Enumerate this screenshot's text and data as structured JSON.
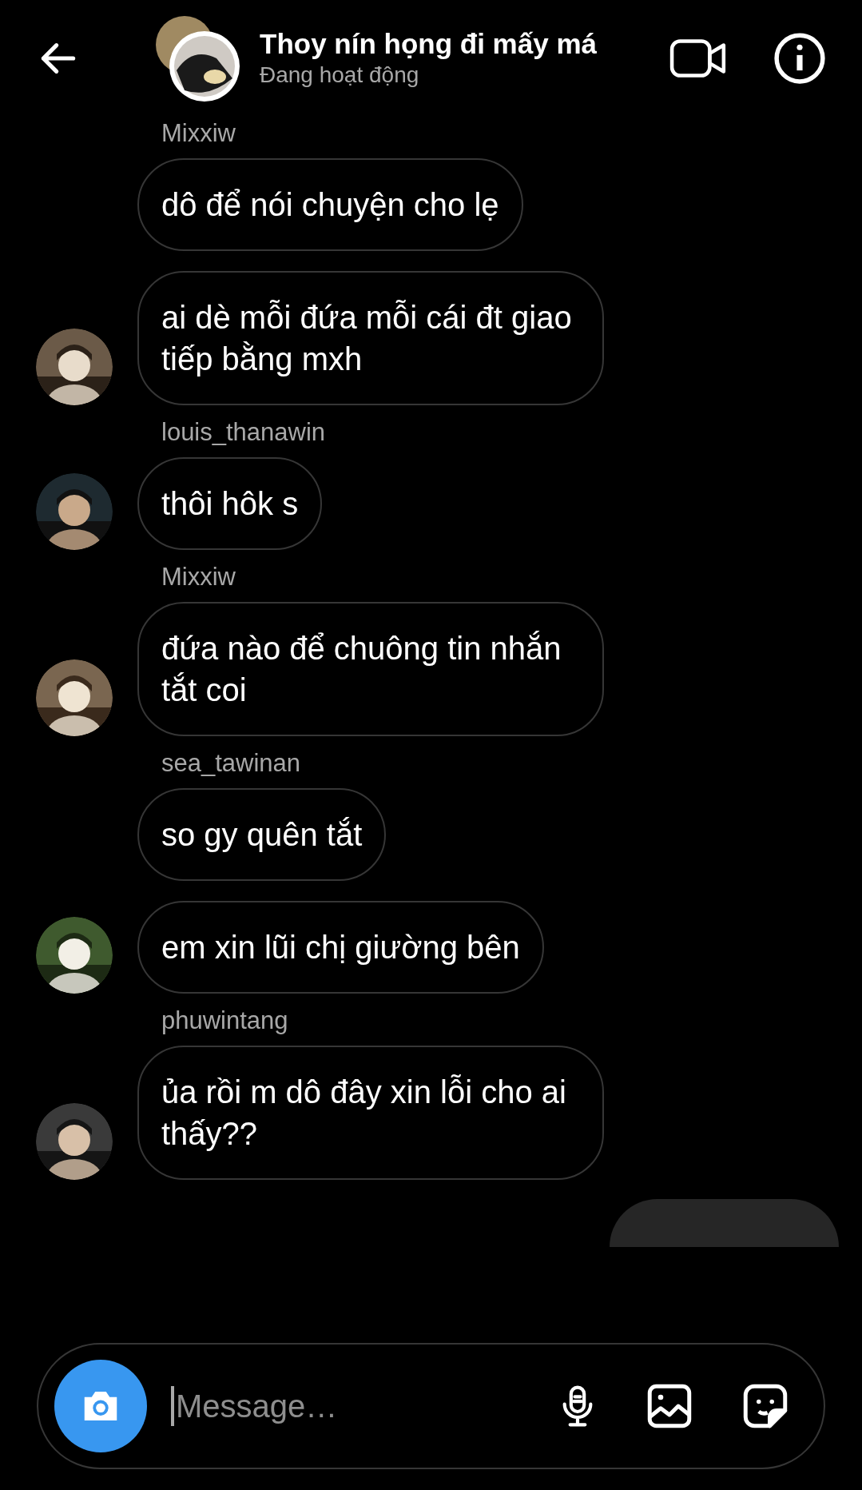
{
  "header": {
    "title": "Thoy nín họng đi mấy má",
    "status": "Đang hoạt động"
  },
  "groups": [
    {
      "sender": "Mixxiw",
      "messages": [
        "dô để nói chuyện cho lẹ",
        "ai dè mỗi đứa mỗi cái đt giao tiếp bằng mxh"
      ]
    },
    {
      "sender": "louis_thanawin",
      "messages": [
        "thôi hôk s"
      ]
    },
    {
      "sender": "Mixxiw",
      "messages": [
        "đứa nào để chuông tin nhắn tắt coi"
      ]
    },
    {
      "sender": "sea_tawinan",
      "messages": [
        "so gy quên tắt",
        "em xin lũi chị giường bên"
      ]
    },
    {
      "sender": "phuwintang",
      "messages": [
        "ủa rồi m dô đây xin lỗi cho ai thấy??"
      ]
    }
  ],
  "composer": {
    "placeholder": "Message…"
  }
}
